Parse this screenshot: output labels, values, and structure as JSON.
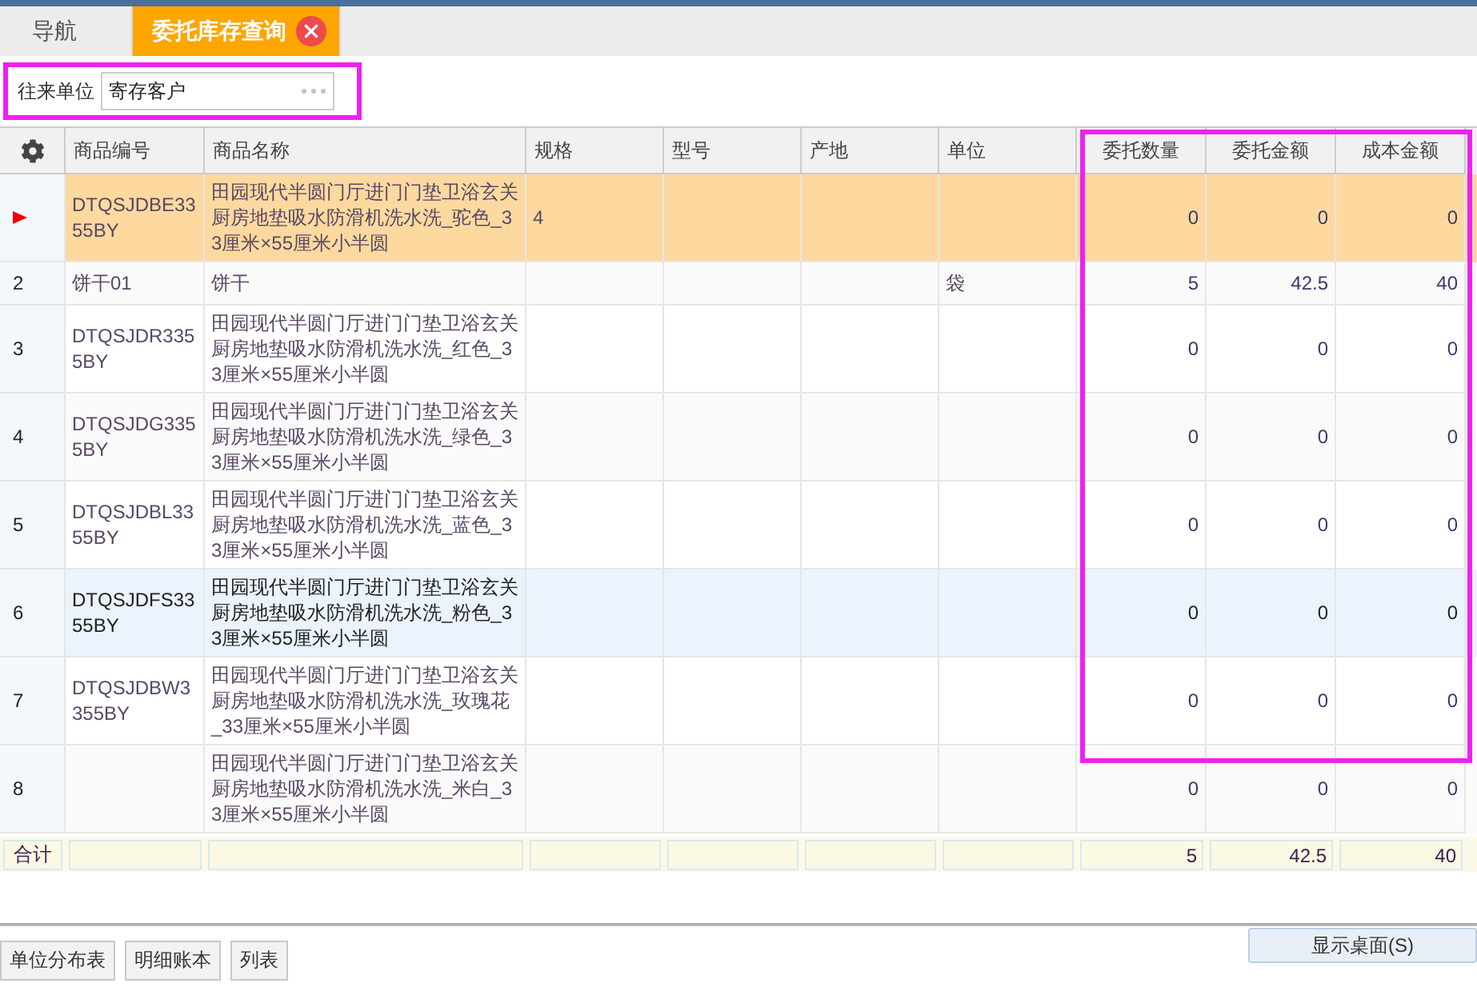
{
  "tabs": [
    {
      "label": "导航",
      "selected": false,
      "closable": false
    },
    {
      "label": "委托库存查询",
      "selected": true,
      "closable": true
    }
  ],
  "filter": {
    "label": "往来单位",
    "value": "寄存客户",
    "highlighted": true
  },
  "table": {
    "columns": [
      {
        "label": "商品编号",
        "kind": "text",
        "highlighted": false
      },
      {
        "label": "商品名称",
        "kind": "text",
        "highlighted": false
      },
      {
        "label": "规格",
        "kind": "text",
        "highlighted": false
      },
      {
        "label": "型号",
        "kind": "text",
        "highlighted": false
      },
      {
        "label": "产地",
        "kind": "text",
        "highlighted": false
      },
      {
        "label": "单位",
        "kind": "text",
        "highlighted": false
      },
      {
        "label": "委托数量",
        "kind": "number",
        "highlighted": true
      },
      {
        "label": "委托金额",
        "kind": "number",
        "highlighted": true
      },
      {
        "label": "成本金额",
        "kind": "number",
        "highlighted": true
      }
    ],
    "rows": [
      {
        "selected": true,
        "hovered": false,
        "cells": [
          "DTQSJDBE3355BY",
          "田园现代半圆门厅进门门垫卫浴玄关厨房地垫吸水防滑机洗水洗_驼色_33厘米×55厘米小半圆",
          "4",
          "",
          "",
          "",
          "0",
          "0",
          "0"
        ]
      },
      {
        "number": "2",
        "selected": false,
        "hovered": false,
        "cells": [
          "饼干01",
          "饼干",
          "",
          "",
          "",
          "袋",
          "5",
          "42.5",
          "40"
        ]
      },
      {
        "number": "3",
        "selected": false,
        "hovered": false,
        "cells": [
          "DTQSJDR3355BY",
          "田园现代半圆门厅进门门垫卫浴玄关厨房地垫吸水防滑机洗水洗_红色_33厘米×55厘米小半圆",
          "",
          "",
          "",
          "",
          "0",
          "0",
          "0"
        ]
      },
      {
        "number": "4",
        "selected": false,
        "hovered": false,
        "cells": [
          "DTQSJDG3355BY",
          "田园现代半圆门厅进门门垫卫浴玄关厨房地垫吸水防滑机洗水洗_绿色_33厘米×55厘米小半圆",
          "",
          "",
          "",
          "",
          "0",
          "0",
          "0"
        ]
      },
      {
        "number": "5",
        "selected": false,
        "hovered": false,
        "cells": [
          "DTQSJDBL3355BY",
          "田园现代半圆门厅进门门垫卫浴玄关厨房地垫吸水防滑机洗水洗_蓝色_33厘米×55厘米小半圆",
          "",
          "",
          "",
          "",
          "0",
          "0",
          "0"
        ]
      },
      {
        "number": "6",
        "selected": false,
        "hovered": true,
        "cells": [
          "DTQSJDFS3355BY",
          "田园现代半圆门厅进门门垫卫浴玄关厨房地垫吸水防滑机洗水洗_粉色_33厘米×55厘米小半圆",
          "",
          "",
          "",
          "",
          "0",
          "0",
          "0"
        ]
      },
      {
        "number": "7",
        "selected": false,
        "hovered": false,
        "cells": [
          "DTQSJDBW3355BY",
          "田园现代半圆门厅进门门垫卫浴玄关厨房地垫吸水防滑机洗水洗_玫瑰花_33厘米×55厘米小半圆",
          "",
          "",
          "",
          "",
          "0",
          "0",
          "0"
        ]
      },
      {
        "number": "8",
        "selected": false,
        "hovered": false,
        "cells": [
          "",
          "田园现代半圆门厅进门门垫卫浴玄关厨房地垫吸水防滑机洗水洗_米白_33厘米×55厘米小半圆",
          "",
          "",
          "",
          "",
          "0",
          "0",
          "0"
        ]
      }
    ],
    "totals": {
      "label": "合计",
      "cells": [
        "",
        "",
        "",
        "",
        "",
        "",
        "5",
        "42.5",
        "40"
      ]
    }
  },
  "buttons": [
    "单位分布表",
    "明细账本",
    "列表"
  ],
  "show_desktop": "显示桌面(S)"
}
